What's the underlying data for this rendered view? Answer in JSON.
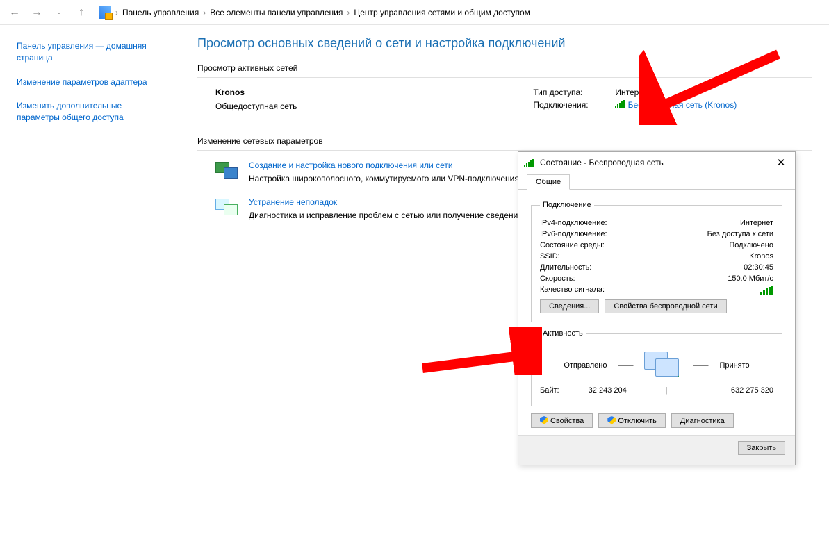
{
  "breadcrumb": {
    "item1": "Панель управления",
    "item2": "Все элементы панели управления",
    "item3": "Центр управления сетями и общим доступом"
  },
  "sidebar": {
    "home": "Панель управления — домашняя страница",
    "adapter": "Изменение параметров адаптера",
    "sharing": "Изменить дополнительные параметры общего доступа"
  },
  "main": {
    "title": "Просмотр основных сведений о сети и настройка подключений",
    "active_label": "Просмотр активных сетей",
    "network_name": "Kronos",
    "network_type": "Общедоступная сеть",
    "access_label": "Тип доступа:",
    "access_value": "Интернет",
    "conn_label": "Подключения:",
    "conn_link": "Беспроводная сеть (Kronos)",
    "change_label": "Изменение сетевых параметров",
    "opt1_link": "Создание и настройка нового подключения или сети",
    "opt1_desc": "Настройка широкополосного, коммутируемого или VPN-подключения либо настройка маршрутизатора или точки доступа.",
    "opt2_link": "Устранение неполадок",
    "opt2_desc": "Диагностика и исправление проблем с сетью или получение сведений об устранении неполадок."
  },
  "dialog": {
    "title": "Состояние - Беспроводная сеть",
    "tab": "Общие",
    "group_conn": "Подключение",
    "ipv4_label": "IPv4-подключение:",
    "ipv4_value": "Интернет",
    "ipv6_label": "IPv6-подключение:",
    "ipv6_value": "Без доступа к сети",
    "media_label": "Состояние среды:",
    "media_value": "Подключено",
    "ssid_label": "SSID:",
    "ssid_value": "Kronos",
    "duration_label": "Длительность:",
    "duration_value": "02:30:45",
    "speed_label": "Скорость:",
    "speed_value": "150.0 Мбит/с",
    "signal_label": "Качество сигнала:",
    "btn_details": "Сведения...",
    "btn_wprops": "Свойства беспроводной сети",
    "group_activity": "Активность",
    "sent_label": "Отправлено",
    "recv_label": "Принято",
    "bytes_label": "Байт:",
    "bytes_sent": "32 243 204",
    "bytes_recv": "632 275 320",
    "btn_props": "Свойства",
    "btn_disable": "Отключить",
    "btn_diag": "Диагностика",
    "btn_close": "Закрыть"
  }
}
